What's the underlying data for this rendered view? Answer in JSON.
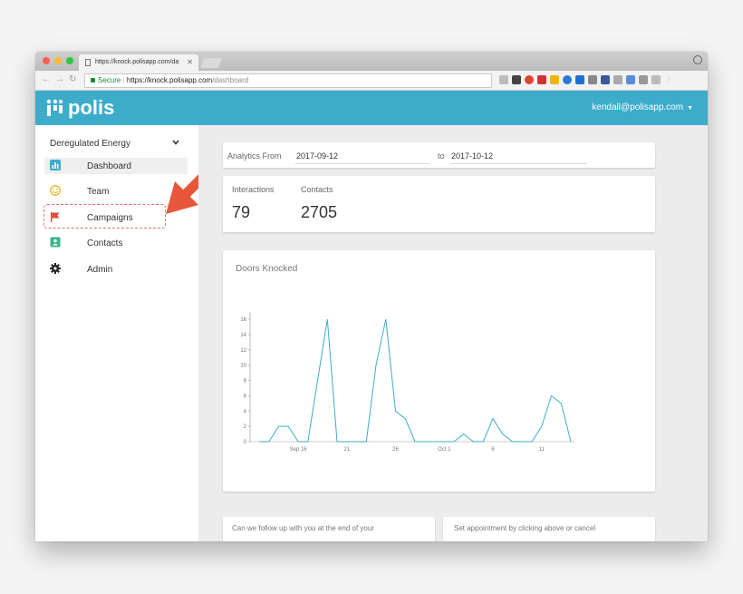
{
  "browser": {
    "tab_title": "https://knock.polisapp.com/da",
    "url_secure_label": "Secure",
    "url_host": "https://knock.polisapp.com",
    "url_path": "/dashboard"
  },
  "header": {
    "brand": "polis",
    "user_email": "kendall@polisapp.com",
    "accent": "#3daccb"
  },
  "sidebar": {
    "org_name": "Deregulated Energy",
    "items": [
      {
        "label": "Dashboard",
        "icon": "bar-chart-icon",
        "active": true
      },
      {
        "label": "Team",
        "icon": "smiley-icon"
      },
      {
        "label": "Campaigns",
        "icon": "flag-icon"
      },
      {
        "label": "Contacts",
        "icon": "contact-card-icon"
      },
      {
        "label": "Admin",
        "icon": "gear-icon"
      }
    ]
  },
  "analytics": {
    "from_label": "Analytics From",
    "from_date": "2017-09-12",
    "to_label": "to",
    "to_date": "2017-10-12"
  },
  "stats": {
    "interactions_label": "Interactions",
    "interactions_value": "79",
    "contacts_label": "Contacts",
    "contacts_value": "2705"
  },
  "bottom_cards": {
    "left_text": "Can we follow up with you at the end of your",
    "right_text": "Set appointment by clicking above or cancel"
  },
  "chart_data": {
    "type": "line",
    "title": "Doors Knocked",
    "ylim": [
      0,
      16
    ],
    "yticks": [
      0,
      2,
      4,
      6,
      8,
      10,
      12,
      14,
      16
    ],
    "x_tick_labels": [
      {
        "day": 4,
        "label": "Sep 16"
      },
      {
        "day": 9,
        "label": "21"
      },
      {
        "day": 14,
        "label": "26"
      },
      {
        "day": 19,
        "label": "Oct 1"
      },
      {
        "day": 24,
        "label": "6"
      },
      {
        "day": 29,
        "label": "11"
      }
    ],
    "series": [
      {
        "color": "#3daccb",
        "values": [
          0,
          0,
          2,
          2,
          0,
          0,
          8,
          16,
          0,
          0,
          0,
          0,
          10,
          16,
          4,
          3,
          0,
          0,
          0,
          0,
          0,
          1,
          0,
          0,
          3,
          1,
          0,
          0,
          0,
          2,
          6,
          5,
          0
        ]
      }
    ]
  }
}
